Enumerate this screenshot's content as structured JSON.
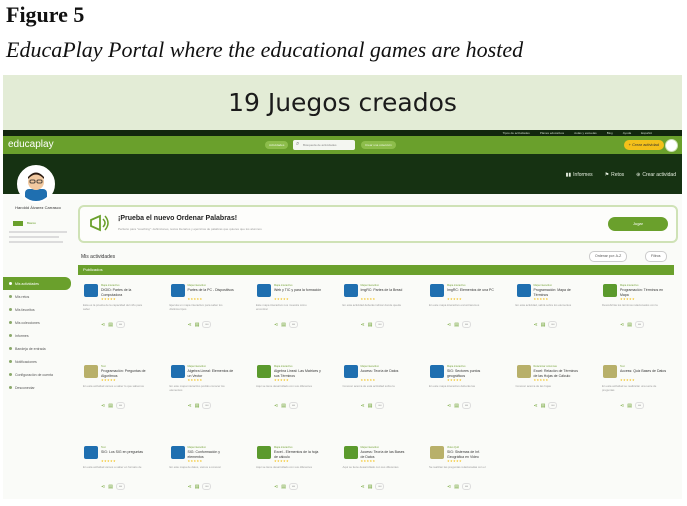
{
  "figure": {
    "label": "Figure 5",
    "caption": "EducaPlay Portal where the educational games are hosted"
  },
  "screenshot": {
    "banner": "19 Juegos creados",
    "top_links": [
      "Tipos de actividades",
      "Planes educativos",
      "Aulas y escuelas",
      "Blog",
      "Ayuda",
      "Español"
    ],
    "nav": {
      "logo": "educaplay",
      "actividades_label": "Actividades",
      "search_placeholder": "Búsqueda de actividades",
      "colecciones_label": "Crear una colección",
      "create_label": "Crear actividad"
    },
    "dark_links": {
      "informes": "Informes",
      "retos": "Retos",
      "crear": "Crear actividad"
    },
    "profile": {
      "name": "Haroldd Álvarez Carrasco",
      "badge": "Básico"
    },
    "sidebar_items": [
      {
        "label": "Mis actividades",
        "active": true
      },
      {
        "label": "Mis retos",
        "active": false
      },
      {
        "label": "Mis favoritos",
        "active": false
      },
      {
        "label": "Mis colecciones",
        "active": false
      },
      {
        "label": "Informes",
        "active": false
      },
      {
        "label": "Bandeja de entrada",
        "active": false
      },
      {
        "label": "Notificaciones",
        "active": false
      },
      {
        "label": "Configuración de cuenta",
        "active": false
      },
      {
        "label": "Desconectar",
        "active": false
      }
    ],
    "promo": {
      "title": "¡Prueba el nuevo Ordenar Palabras!",
      "subtitle": "Perfecto para \"coaching\": definiciones, textos literarios y ejercicios de palabras que quieres que los alumnos",
      "button": "Jugar"
    },
    "section": {
      "title": "Mis actividades",
      "sort_label": "Ordenar por: A-Z",
      "filter_label": "Filtros",
      "published_label": "Publicados"
    },
    "card_colors": {
      "blue": "#1f6fb0",
      "green": "#5b9a2d",
      "olive": "#b8b06a",
      "accent": "#6aa02c"
    },
    "cards": [
      {
        "type": "Mapa interactivo",
        "title": "DIGID: Partes de la Computadora",
        "desc": "Esta es la prueba de la capacidad del niño para saber",
        "thumb": "blue"
      },
      {
        "type": "Mapa interactivo",
        "title": "Partes de la PC - Dispositivos",
        "desc": "Ejecuta un mapa interactivo para saber los distintos tipos",
        "thumb": "blue"
      },
      {
        "type": "Mapa interactivo",
        "title": "Web y TIC y para la formación",
        "desc": "Este mapa interactivo nos muestra cómo encontrar",
        "thumb": "blue"
      },
      {
        "type": "Mapa interactivo",
        "title": "ImgRC: Partes de la Bread",
        "desc": "En esta actividad deberás indicar donde queda",
        "thumb": "blue"
      },
      {
        "type": "Mapa interactivo",
        "title": "ImgRC: Elementos de una PC",
        "desc": "En este mapa interactivo encontraremos",
        "thumb": "blue"
      },
      {
        "type": "Mapa interactivo",
        "title": "Programación: Mapa de Términos",
        "desc": "En esta actividad, sabrá sobre los elementos",
        "thumb": "blue"
      },
      {
        "type": "Mapa interactivo",
        "title": "Programación: Términos en Mapa",
        "desc": "Descubrirás los términos relacionados con la",
        "thumb": "green"
      },
      {
        "type": "Test",
        "title": "Programación: Preguntas de Algoritmos",
        "desc": "En esta actividad vamos a saber lo que sabemos",
        "thumb": "olive"
      },
      {
        "type": "Mapa interactivo",
        "title": "Algebra Lineal: Elementos de un Vector",
        "desc": "En este mapa interactivo podrás conocer los elementos",
        "thumb": "blue"
      },
      {
        "type": "Mapa interactivo",
        "title": "Algebra Lineal: Las Matrices y sus Términos",
        "desc": "Aquí se tiene desarrollado con sus diferentes",
        "thumb": "green"
      },
      {
        "type": "Mapa interactivo",
        "title": "Access: Teoría de Datos",
        "desc": "Conocer acerca de esta actividad sobre la",
        "thumb": "blue"
      },
      {
        "type": "Mapa interactivo",
        "title": "SIG: Sectores puntos geográficos",
        "desc": "En este mapa interactivo deberás las",
        "thumb": "blue"
      },
      {
        "type": "Relacionar columnas",
        "title": "Excel: Relación de Términos de las Hojas de Cálculo",
        "desc": "Conocer acerca de las hojas",
        "thumb": "olive"
      },
      {
        "type": "Test",
        "title": "Access: Quiz Bases de Datos",
        "desc": "En esta actividad se realizarán una serie de preguntas",
        "thumb": "olive"
      },
      {
        "type": "Test",
        "title": "SIG: Los SIG en preguntas",
        "desc": "En esta actividad vamos a saber en formato de",
        "thumb": "blue"
      },
      {
        "type": "Mapa interactivo",
        "title": "SIG: Conformación y elementos",
        "desc": "En este mapa de datos, vamos a conocer",
        "thumb": "blue"
      },
      {
        "type": "Mapa interactivo",
        "title": "Excel - Elementos de la hoja de cálculo",
        "desc": "Aquí se tiene desarrollado con sus diferentes",
        "thumb": "green"
      },
      {
        "type": "Mapa interactivo",
        "title": "Access: Teoría de las Bases de Datos",
        "desc": "Aquí se tiene desarrollado con sus diferentes",
        "thumb": "green"
      },
      {
        "type": "Video Quiz",
        "title": "SIG: Sistemas de Inf. Geográfica en Video",
        "desc": "Se realizan las preguntas relacionadas con el",
        "thumb": "olive"
      }
    ]
  }
}
